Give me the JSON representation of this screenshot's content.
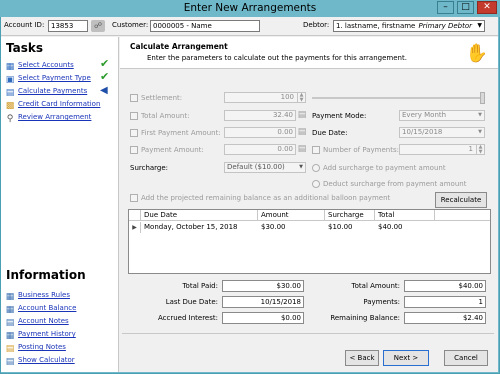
{
  "window": {
    "title": "Enter New Arrangements",
    "minimize": "–",
    "maximize": "□",
    "close": "✕"
  },
  "topbar": {
    "account_label": "Account ID:",
    "account_value": "13853",
    "customer_label": "Customer:",
    "customer_value": "0000005 - Name",
    "debtor_label": "Debtor:",
    "debtor_value": "1. lastname, firstname",
    "debtor_type": "Primary Debtor"
  },
  "sidebar": {
    "tasks_heading": "Tasks",
    "tasks": [
      {
        "label": "Select Accounts",
        "icon": "accounts-icon",
        "status": "✔"
      },
      {
        "label": "Select Payment Type",
        "icon": "payment-type-icon",
        "status": "✔"
      },
      {
        "label": "Calculate Payments",
        "icon": "calculator-icon",
        "status": "◀"
      },
      {
        "label": "Credit Card Information",
        "icon": "credit-card-icon",
        "status": ""
      },
      {
        "label": "Review Arrangement",
        "icon": "review-icon",
        "status": ""
      }
    ],
    "info_heading": "Information",
    "info": [
      {
        "label": "Business Rules",
        "icon": "business-rules-icon"
      },
      {
        "label": "Account Balance",
        "icon": "account-balance-icon"
      },
      {
        "label": "Account Notes",
        "icon": "account-notes-icon"
      },
      {
        "label": "Payment History",
        "icon": "payment-history-icon"
      },
      {
        "label": "Posting Notes",
        "icon": "posting-notes-icon"
      },
      {
        "label": "Show Calculator",
        "icon": "calculator-icon"
      }
    ]
  },
  "main": {
    "heading": "Calculate Arrangement",
    "subheading": "Enter the parameters to calculate out the payments for this arrangement.",
    "settlement_label": "Settlement:",
    "settlement_value": "100",
    "total_amount_label": "Total Amount:",
    "total_amount_value": "32.40",
    "first_payment_label": "First Payment Amount:",
    "first_payment_value": "0.00",
    "payment_amount_label": "Payment Amount:",
    "payment_amount_value": "0.00",
    "payment_mode_label": "Payment Mode:",
    "payment_mode_value": "Every Month",
    "due_date_label": "Due Date:",
    "due_date_value": "10/15/2018",
    "num_payments_label": "Number of Payments:",
    "num_payments_value": "1",
    "surcharge_label": "Surcharge:",
    "surcharge_value": "Default ($10.00)",
    "add_surcharge_label": "Add surcharge to payment amount",
    "deduct_surcharge_label": "Deduct surcharge from payment amount",
    "balloon_label": "Add the projected remaining balance as an additional balloon payment",
    "recalculate_label": "Recalculate"
  },
  "grid": {
    "columns": [
      "Due Date",
      "Amount",
      "Surcharge",
      "Total"
    ],
    "rows": [
      {
        "due_date": "Monday, October 15, 2018",
        "amount": "$30.00",
        "surcharge": "$10.00",
        "total": "$40.00"
      }
    ]
  },
  "totals": {
    "total_paid_label": "Total Paid:",
    "total_paid_value": "$30.00",
    "last_due_date_label": "Last Due Date:",
    "last_due_date_value": "10/15/2018",
    "accrued_interest_label": "Accrued Interest:",
    "accrued_interest_value": "$0.00",
    "total_amount_label": "Total Amount:",
    "total_amount_value": "$40.00",
    "payments_label": "Payments:",
    "payments_value": "1",
    "remaining_balance_label": "Remaining Balance:",
    "remaining_balance_value": "$2.40"
  },
  "footer": {
    "back_label": "< Back",
    "next_label": "Next >",
    "cancel_label": "Cancel"
  },
  "colors": {
    "titlebar": "#6fb8c9",
    "link": "#1a34b8",
    "check": "#2a9a2a",
    "close": "#c43a2c"
  }
}
